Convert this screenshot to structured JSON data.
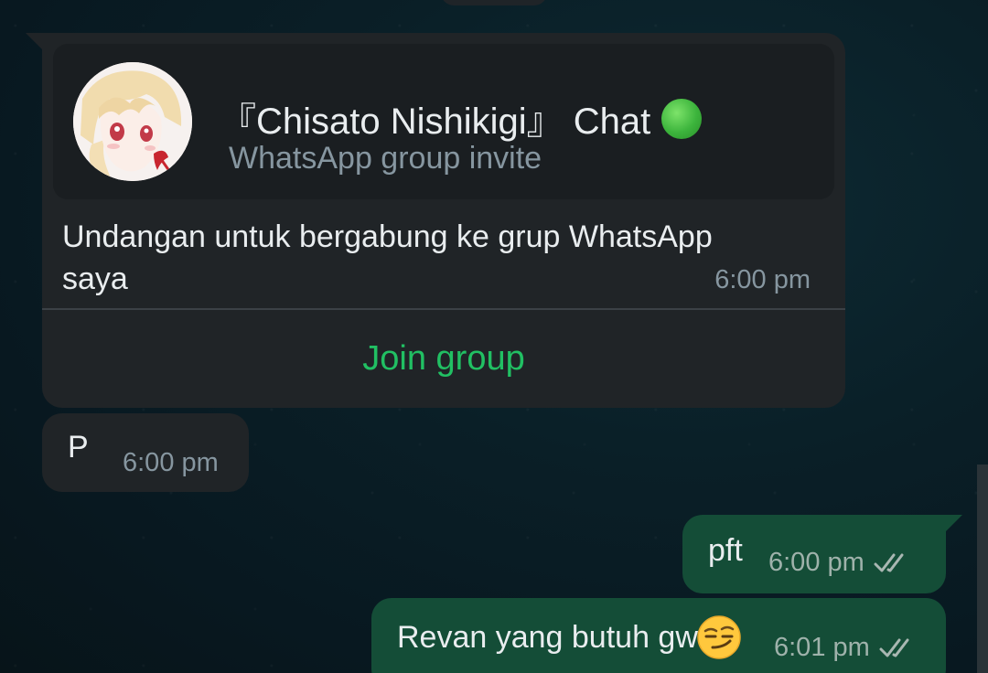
{
  "invite": {
    "group_name": "『Chisato Nishikigi』 Chat",
    "subtitle": "WhatsApp group invite",
    "message": "Undangan untuk bergabung ke grup WhatsApp saya",
    "time": "6:00 pm",
    "join_label": "Join group",
    "avatar_icon": "anime-avatar-icon",
    "status_icon": "green-circle-emoji"
  },
  "messages": [
    {
      "direction": "incoming",
      "text": "P",
      "time": "6:00 pm"
    },
    {
      "direction": "outgoing",
      "text": "pft",
      "time": "6:00 pm",
      "status": "read-ticks-icon"
    },
    {
      "direction": "outgoing",
      "text": "Revan yang butuh gw",
      "emoji": "smirking-face-emoji",
      "time": "6:01 pm",
      "status": "read-ticks-icon"
    }
  ],
  "colors": {
    "incoming_bubble": "#202427",
    "outgoing_bubble": "#144d37",
    "accent_green": "#21c063",
    "meta_text": "#8696a0"
  }
}
